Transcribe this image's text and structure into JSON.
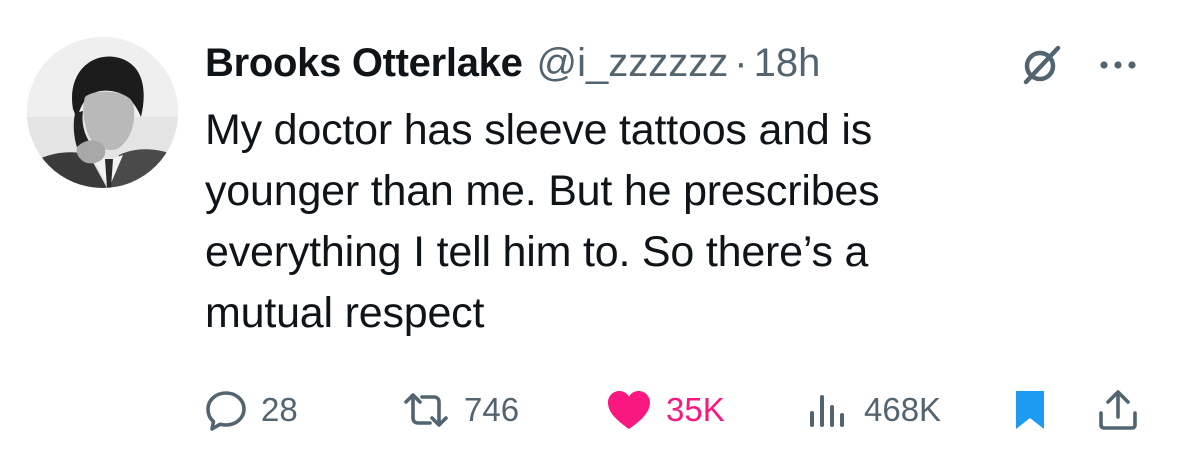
{
  "tweet": {
    "display_name": "Brooks Otterlake",
    "handle": "@i_zzzzzz",
    "separator": "·",
    "time": "18h",
    "text": "My doctor has sleeve tattoos and is\nyounger than me. But he prescribes\neverything I tell him to. So there’s a\nmutual respect"
  },
  "actions": {
    "replies": "28",
    "reposts": "746",
    "likes": "35K",
    "views": "468K"
  },
  "icons": {
    "grok": "grok-icon",
    "more": "more-icon",
    "reply": "reply-icon",
    "repost": "repost-icon",
    "like": "heart-icon",
    "views": "views-icon",
    "bookmark": "bookmark-icon",
    "share": "share-icon"
  },
  "colors": {
    "text": "#0f1419",
    "secondary": "#536471",
    "like": "#f91880",
    "bookmark": "#1d9bf0"
  }
}
